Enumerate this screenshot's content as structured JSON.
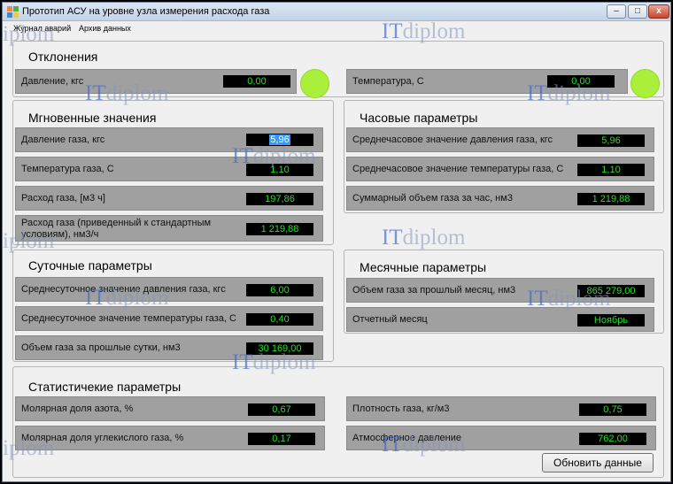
{
  "window": {
    "title": "Прототип АСУ на уровне узла измерения расхода газа",
    "minimize_glyph": "–",
    "maximize_glyph": "□",
    "close_glyph": "x"
  },
  "menu": {
    "alarms": "Журнал аварий",
    "archive": "Архив данных"
  },
  "deviations": {
    "title": "Отклонения",
    "pressure": {
      "label": "Давление, кгс",
      "value": "0,00"
    },
    "temperature": {
      "label": "Температура, С",
      "value": "0,00"
    },
    "indicator_color": "#aaf03a"
  },
  "instant": {
    "title": "Мгновенные значения",
    "rows": [
      {
        "label": "Давление газа, кгс",
        "value": "5,96"
      },
      {
        "label": "Температура газа, С",
        "value": "1,10"
      },
      {
        "label": "Расход газа, [м3 ч]",
        "value": "197,86"
      },
      {
        "label": "Расход газа (приведенный к стандартным условиям), нм3/ч",
        "value": "1 219,88"
      }
    ]
  },
  "hourly": {
    "title": "Часовые параметры",
    "rows": [
      {
        "label": "Среднечасовое значение давления газа, кгс",
        "value": "5,96"
      },
      {
        "label": "Среднечасовое значение температуры газа, С",
        "value": "1,10"
      },
      {
        "label": "Суммарный объем газа за час, нм3",
        "value": "1 219,88"
      }
    ]
  },
  "daily": {
    "title": "Суточные параметры",
    "rows": [
      {
        "label": "Среднесуточное значение давления газа, кгс",
        "value": "6,00"
      },
      {
        "label": "Среднесуточное значение температуры газа, С",
        "value": "0,40"
      },
      {
        "label": "Объем газа за прошлые сутки, нм3",
        "value": "30 169,00"
      }
    ]
  },
  "monthly": {
    "title": "Месячные параметры",
    "rows": [
      {
        "label": "Объем газа за прошлый месяц, нм3",
        "value": "865 279,00"
      },
      {
        "label": "Отчетный месяц",
        "value": "Ноябрь"
      }
    ]
  },
  "stats": {
    "title": "Статистичекие параметры",
    "left": [
      {
        "label": "Молярная доля азота, %",
        "value": "0,67"
      },
      {
        "label": "Молярная доля углекислого газа, %",
        "value": "0,17"
      }
    ],
    "right": [
      {
        "label": "Плотность газа, кг/м3",
        "value": "0,75"
      },
      {
        "label": "Атмосферное давление",
        "value": "762,00"
      }
    ]
  },
  "refresh_button": "Обновить данные",
  "watermark": {
    "it": "IT",
    "diplom": "diplom",
    "fragment": "iplom"
  },
  "colors": {
    "value_text": "#22e022",
    "value_bg": "#000000",
    "row_bg": "#a0a0a0",
    "window_bg": "#f0f0f0"
  }
}
